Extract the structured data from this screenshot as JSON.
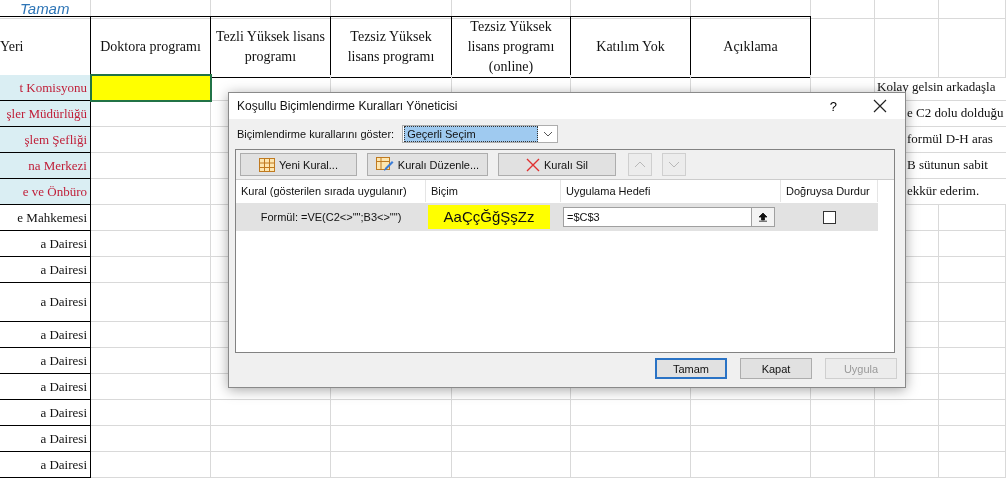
{
  "sheet": {
    "title": "Tamam",
    "headers": [
      "Yeri",
      "Doktora programı",
      "Tezli Yüksek lisans programı",
      "Tezsiz Yüksek lisans programı",
      "Tezsiz Yüksek lisans programı (online)",
      "Katılım Yok",
      "Açıklama"
    ],
    "rows": [
      {
        "name": "t Komisyonu",
        "highlighted": true,
        "active": true,
        "color": "#ffff00",
        "note": "Kolay gelsin arkadaşla"
      },
      {
        "name": "şler Müdürlüğü",
        "highlighted": true,
        "active": false,
        "note": "e C2 dolu dolduğu"
      },
      {
        "name": "şlem Şefliği",
        "highlighted": true,
        "active": false,
        "note": "formül D-H aras"
      },
      {
        "name": "na Merkezi",
        "highlighted": true,
        "active": false,
        "note": "B sütunun sabit"
      },
      {
        "name": "e ve Önbüro",
        "highlighted": true,
        "active": false,
        "note": "ekkür ederim."
      },
      {
        "name": "e Mahkemesi",
        "highlighted": false,
        "active": false
      },
      {
        "name": "a Dairesi",
        "highlighted": false,
        "active": false
      },
      {
        "name": "a Dairesi",
        "highlighted": false,
        "active": false
      },
      {
        "name": "a Dairesi",
        "highlighted": false,
        "active": false
      },
      {
        "name": "a Dairesi",
        "highlighted": false,
        "active": false
      },
      {
        "name": "a Dairesi",
        "highlighted": false,
        "active": false
      },
      {
        "name": "a Dairesi",
        "highlighted": false,
        "active": false
      },
      {
        "name": "a Dairesi",
        "highlighted": false,
        "active": false
      },
      {
        "name": "a Dairesi",
        "highlighted": false,
        "active": false
      },
      {
        "name": "a Dairesi",
        "highlighted": false,
        "active": false
      }
    ]
  },
  "dialog": {
    "title": "Koşullu Biçimlendirme Kuralları Yöneticisi",
    "help": "?",
    "show_label": "Biçimlendirme kurallarını göster:",
    "show_value": "Geçerli Seçim",
    "toolbar": [
      {
        "kind": "new",
        "label": "Yeni Kural...",
        "disabled": false
      },
      {
        "kind": "edit",
        "label": "Kuralı Düzenle...",
        "disabled": false
      },
      {
        "kind": "delete",
        "label": "Kuralı Sil",
        "disabled": false
      },
      {
        "kind": "up",
        "disabled": true
      },
      {
        "kind": "down",
        "disabled": true
      }
    ],
    "columns": [
      "Kural (gösterilen sırada uygulanır)",
      "Biçim",
      "Uygulama Hedefi",
      "Doğruysa Durdur"
    ],
    "rules": [
      {
        "rule": "Formül: =VE(C2<>\"\";B3<>\"\")",
        "preview": "AaÇçĞğŞşZz",
        "color": "#ffff00",
        "applies_to": "=$C$3",
        "stop_if_true": false,
        "selected": true
      }
    ],
    "buttons": [
      {
        "label": "Tamam",
        "default": true,
        "disabled": false
      },
      {
        "label": "Kapat",
        "default": false,
        "disabled": false
      },
      {
        "label": "Uygula",
        "default": false,
        "disabled": true
      }
    ]
  }
}
